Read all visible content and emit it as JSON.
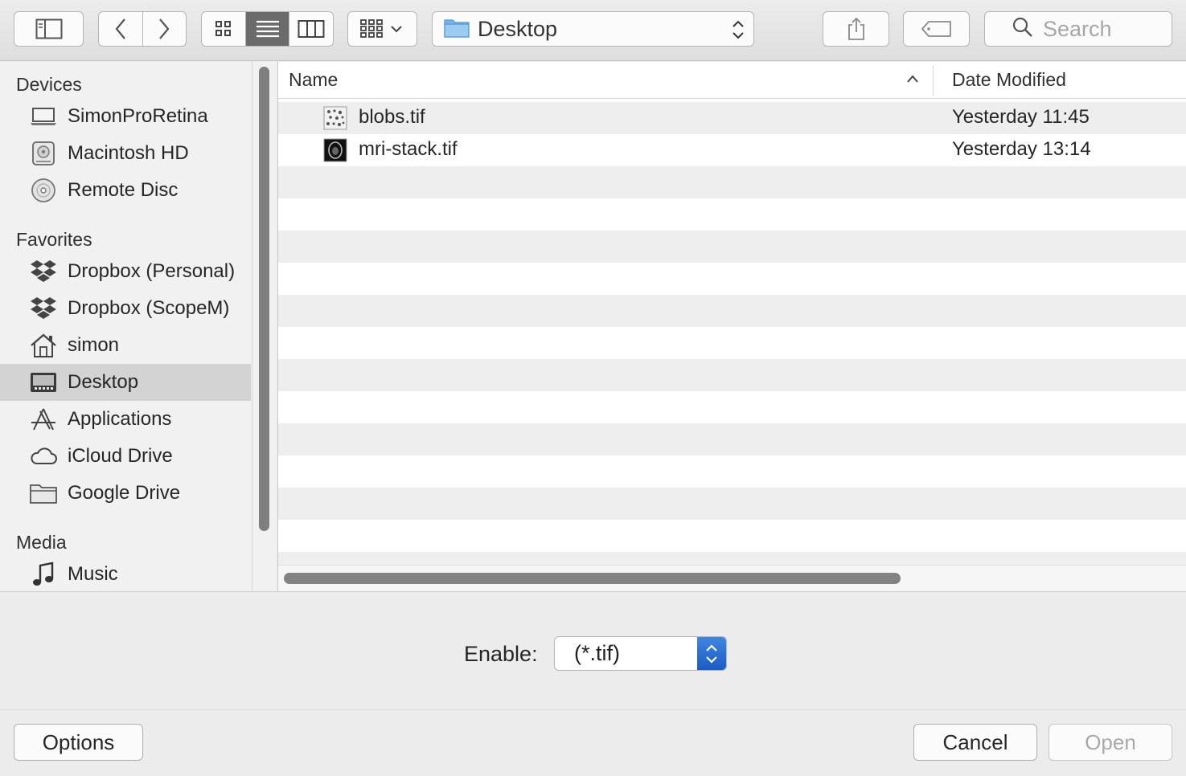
{
  "toolbar": {
    "location": "Desktop",
    "search_placeholder": "Search"
  },
  "sidebar": {
    "sections": [
      {
        "title": "Devices"
      },
      {
        "title": "Favorites"
      },
      {
        "title": "Media"
      }
    ],
    "devices": [
      {
        "label": "SimonProRetina",
        "icon": "laptop-icon"
      },
      {
        "label": "Macintosh HD",
        "icon": "hard-drive-icon"
      },
      {
        "label": "Remote Disc",
        "icon": "disc-icon"
      }
    ],
    "favorites": [
      {
        "label": "Dropbox (Personal)",
        "icon": "dropbox-icon"
      },
      {
        "label": "Dropbox (ScopeM)",
        "icon": "dropbox-icon"
      },
      {
        "label": "simon",
        "icon": "home-icon"
      },
      {
        "label": "Desktop",
        "icon": "desktop-icon",
        "selected": true
      },
      {
        "label": "Applications",
        "icon": "applications-icon"
      },
      {
        "label": "iCloud Drive",
        "icon": "cloud-icon"
      },
      {
        "label": "Google Drive",
        "icon": "folder-icon"
      }
    ],
    "media": [
      {
        "label": "Music",
        "icon": "music-icon"
      }
    ]
  },
  "filelist": {
    "columns": {
      "name": "Name",
      "date": "Date Modified"
    },
    "files": [
      {
        "name": "blobs.tif",
        "date": "Yesterday 11:45"
      },
      {
        "name": "mri-stack.tif",
        "date": "Yesterday 13:14"
      }
    ]
  },
  "accessory": {
    "enable_label": "Enable:",
    "enable_value": "(*.tif)"
  },
  "footer": {
    "options": "Options",
    "cancel": "Cancel",
    "open": "Open"
  },
  "colors": {
    "accent": "#1a5cc5",
    "selection": "#d3d3d3",
    "row_alt": "#eeeeee"
  }
}
